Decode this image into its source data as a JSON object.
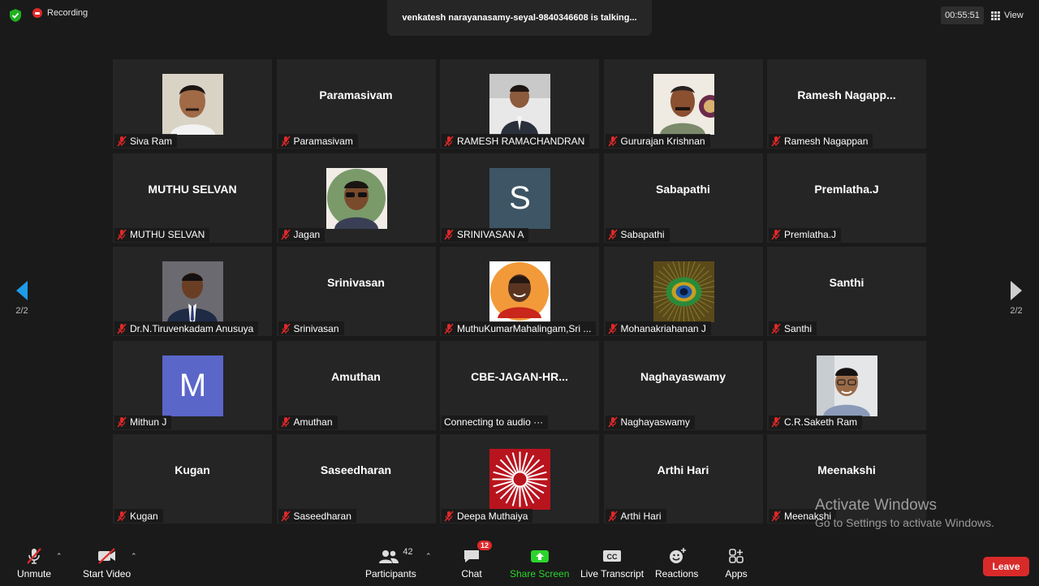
{
  "top_bar": {
    "recording_label": "Recording",
    "talking_banner": "venkatesh narayanasamy-seyal-9840346608 is talking...",
    "timer": "00:55:51",
    "view_label": "View"
  },
  "gallery": {
    "page_indicator_left": "2/2",
    "page_indicator_right": "2/2",
    "tiles": [
      {
        "center_name": "",
        "label": "Siva Ram",
        "avatar": "photo-man-1"
      },
      {
        "center_name": "Paramasivam",
        "label": "Paramasivam",
        "avatar": ""
      },
      {
        "center_name": "",
        "label": "RAMESH RAMACHANDRAN",
        "avatar": "photo-man-suit"
      },
      {
        "center_name": "",
        "label": "Gururajan Krishnan",
        "avatar": "photo-man-mustache"
      },
      {
        "center_name": "Ramesh  Nagapp...",
        "label": "Ramesh Nagappan",
        "avatar": ""
      },
      {
        "center_name": "MUTHU SELVAN",
        "label": "MUTHU SELVAN",
        "avatar": ""
      },
      {
        "center_name": "",
        "label": "Jagan",
        "avatar": "photo-man-sunglasses"
      },
      {
        "center_name": "",
        "label": "SRINIVASAN A",
        "avatar": "letter",
        "letter": "S",
        "letter_bg": "#3d5564"
      },
      {
        "center_name": "Sabapathi",
        "label": "Sabapathi",
        "avatar": ""
      },
      {
        "center_name": "Premlatha.J",
        "label": "Premlatha.J",
        "avatar": ""
      },
      {
        "center_name": "",
        "label": "Dr.N.Tiruvenkadam Anusuya",
        "avatar": "photo-man-tie"
      },
      {
        "center_name": "Srinivasan",
        "label": "Srinivasan",
        "avatar": ""
      },
      {
        "center_name": "",
        "label": "MuthuKumarMahalingam,Sri ...",
        "avatar": "photo-man-orange"
      },
      {
        "center_name": "",
        "label": "Mohanakriahanan J",
        "avatar": "photo-peacock"
      },
      {
        "center_name": "Santhi",
        "label": "Santhi",
        "avatar": ""
      },
      {
        "center_name": "",
        "label": "Mithun J",
        "avatar": "letter",
        "letter": "M",
        "letter_bg": "#5b66c9"
      },
      {
        "center_name": "Amuthan",
        "label": "Amuthan",
        "avatar": ""
      },
      {
        "center_name": "CBE-JAGAN-HR...",
        "label": "Connecting to audio ···",
        "avatar": "",
        "no_mute_icon": true
      },
      {
        "center_name": "Naghayaswamy",
        "label": "Naghayaswamy",
        "avatar": ""
      },
      {
        "center_name": "",
        "label": "C.R.Saketh Ram",
        "avatar": "photo-man-glasses"
      },
      {
        "center_name": "Kugan",
        "label": "Kugan",
        "avatar": ""
      },
      {
        "center_name": "Saseedharan",
        "label": "Saseedharan",
        "avatar": ""
      },
      {
        "center_name": "",
        "label": "Deepa Muthaiya",
        "avatar": "logo-burst"
      },
      {
        "center_name": "Arthi Hari",
        "label": "Arthi Hari",
        "avatar": ""
      },
      {
        "center_name": "Meenakshi",
        "label": "Meenakshi",
        "avatar": ""
      }
    ]
  },
  "watermark": {
    "line1": "Activate Windows",
    "line2": "Go to Settings to activate Windows."
  },
  "toolbar": {
    "unmute": "Unmute",
    "start_video": "Start Video",
    "participants": "Participants",
    "participants_count": "42",
    "chat": "Chat",
    "chat_badge": "12",
    "share_screen": "Share Screen",
    "live_transcript": "Live Transcript",
    "reactions": "Reactions",
    "apps": "Apps",
    "leave": "Leave"
  },
  "colors": {
    "background": "#1a1a1a",
    "tile": "#252525",
    "mute_red": "#e02828",
    "share_green": "#2cd42c",
    "leave_red": "#d92a2a"
  }
}
